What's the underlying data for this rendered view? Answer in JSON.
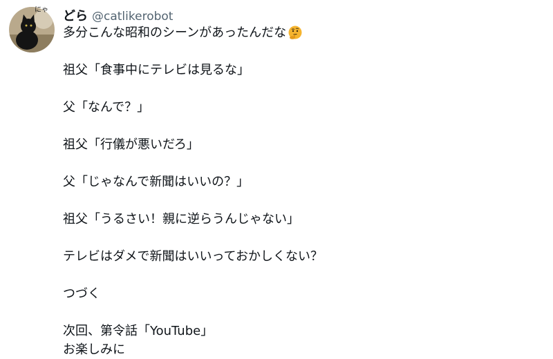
{
  "user": {
    "avatar_badge": "にゃ",
    "display_name": "どら",
    "handle": "@catlikerobot"
  },
  "tweet": {
    "lines": [
      "多分こんな昭和のシーンがあったんだな",
      "祖父「食事中にテレビは見るな」",
      "父「なんで？」",
      "祖父「行儀が悪いだろ」",
      "父「じゃなんで新聞はいいの？」",
      "祖父「うるさい！親に逆らうんじゃない」",
      "テレビはダメで新聞はいいっておかしくない？",
      "つづく",
      "次回、第令話「YouTube」",
      "お楽しみに"
    ],
    "emoji": "thinking-face"
  },
  "colors": {
    "text": "#0f1419",
    "handle": "#536471",
    "emoji_yellow": "#f5b42f"
  }
}
